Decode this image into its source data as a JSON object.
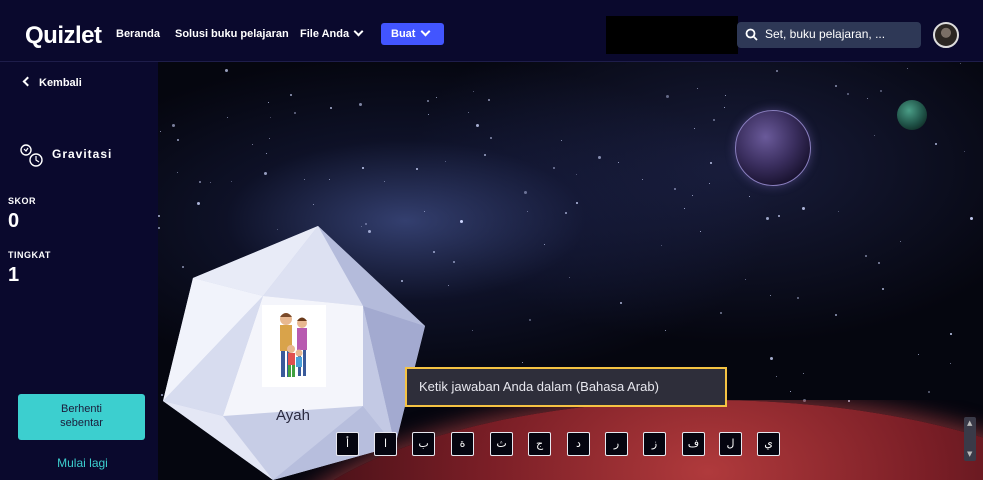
{
  "header": {
    "logo": "Quizlet",
    "nav": [
      "Beranda",
      "Solusi buku pelajaran",
      "File Anda"
    ],
    "create_label": "Buat",
    "search_placeholder": "Set, buku pelajaran, ..."
  },
  "sidebar": {
    "back_label": "Kembali",
    "mode_label": "Gravitasi",
    "score_label": "SKOR",
    "score_value": "0",
    "level_label": "TINGKAT",
    "level_value": "1",
    "pause_label": "Berhenti sebentar",
    "restart_label": "Mulai lagi"
  },
  "game": {
    "card_word": "Ayah",
    "answer_placeholder": "Ketik jawaban Anda dalam (Bahasa Arab)",
    "keys": [
      "أ",
      "ا",
      "ب",
      "ة",
      "ث",
      "ج",
      "د",
      "ر",
      "ز",
      "ف",
      "ل",
      "ي"
    ]
  },
  "colors": {
    "background": "#0a092d",
    "accent": "#4255ff",
    "pause_button": "#3ccfcf",
    "input_border": "#f5c343"
  }
}
